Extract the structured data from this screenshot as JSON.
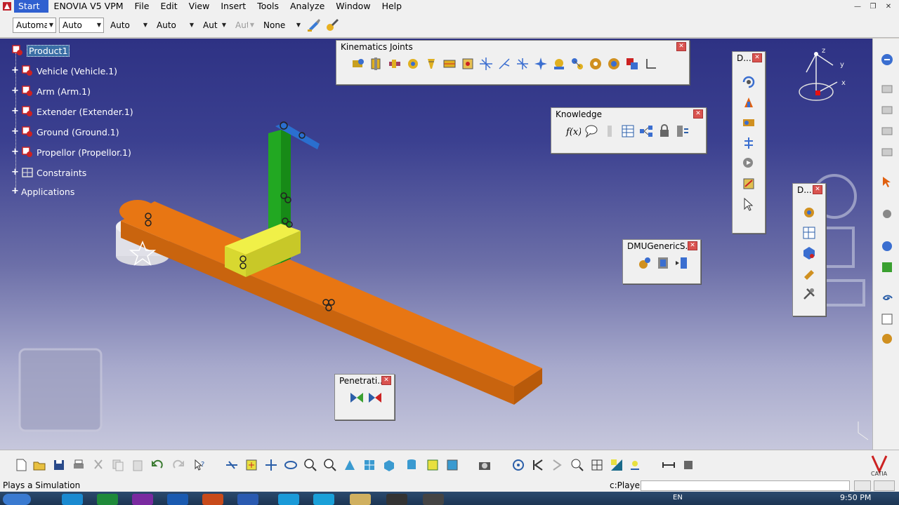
{
  "menubar": {
    "items": [
      "Start",
      "ENOVIA V5 VPM",
      "File",
      "Edit",
      "View",
      "Insert",
      "Tools",
      "Analyze",
      "Window",
      "Help"
    ]
  },
  "toolbar": {
    "combos": [
      {
        "value": "Automa",
        "disabled": false
      },
      {
        "value": "Auto",
        "disabled": false
      },
      {
        "value": "Auto",
        "disabled": false
      },
      {
        "value": "Auto",
        "disabled": false
      },
      {
        "value": "Aut",
        "disabled": false
      },
      {
        "value": "Aut",
        "disabled": true
      },
      {
        "value": "None",
        "disabled": false
      }
    ]
  },
  "tree": {
    "root": "Product1",
    "nodes": [
      {
        "label": "Vehicle (Vehicle.1)",
        "icon": "product-icon"
      },
      {
        "label": "Arm (Arm.1)",
        "icon": "product-icon"
      },
      {
        "label": "Extender (Extender.1)",
        "icon": "product-icon"
      },
      {
        "label": "Ground (Ground.1)",
        "icon": "product-icon"
      },
      {
        "label": "Propellor (Propellor.1)",
        "icon": "product-icon"
      },
      {
        "label": "Constraints",
        "icon": "constraints-icon"
      },
      {
        "label": "Applications",
        "icon": "none"
      }
    ]
  },
  "floating_toolbars": {
    "kinematics": {
      "title": "Kinematics Joints",
      "icon_count": 17
    },
    "knowledge": {
      "title": "Knowledge",
      "icon_count": 6
    },
    "d1": {
      "title": "D...",
      "icon_count": 7
    },
    "d2": {
      "title": "D...",
      "icon_count": 5
    },
    "dmu_generic": {
      "title": "DMUGenericS...",
      "icon_count": 3
    },
    "penetration": {
      "title": "Penetrati...",
      "icon_count": 2
    }
  },
  "compass": {
    "x": "x",
    "y": "y",
    "z": "z"
  },
  "status": {
    "message": "Plays a Simulation",
    "command_label": "c:Player"
  },
  "taskbar": {
    "time": "9:50 PM",
    "lang": "EN"
  },
  "colors": {
    "viewport_top": "#2e3284",
    "viewport_bottom": "#c6c7dc",
    "arm_orange": "#e26d0b",
    "extender_green": "#1fb01f",
    "vehicle_yellow": "#e8e83a",
    "propellor_blue": "#2a6fcf"
  }
}
